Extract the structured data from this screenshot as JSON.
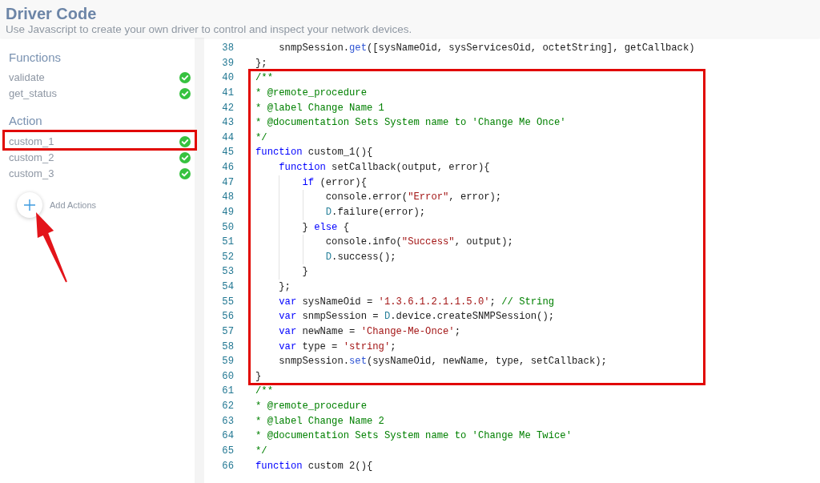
{
  "header": {
    "title": "Driver Code",
    "subtitle": "Use Javascript to create your own driver to control and inspect your network devices."
  },
  "sidebar": {
    "sections": [
      {
        "heading": "Functions",
        "items": [
          {
            "name": "validate",
            "valid": true,
            "highlighted": false
          },
          {
            "name": "get_status",
            "valid": true,
            "highlighted": false
          }
        ]
      },
      {
        "heading": "Action",
        "items": [
          {
            "name": "custom_1",
            "valid": true,
            "highlighted": true
          },
          {
            "name": "custom_2",
            "valid": true,
            "highlighted": false
          },
          {
            "name": "custom_3",
            "valid": true,
            "highlighted": false
          }
        ]
      }
    ],
    "add_button": {
      "label": "Add Actions",
      "pointer_arrow": true
    }
  },
  "editor": {
    "blocks": [
      {
        "highlighted": false,
        "lines": [
          {
            "number": "38",
            "tokens": [
              {
                "kind": "plain",
                "text": "    snmpSession."
              },
              {
                "kind": "method",
                "text": "get"
              },
              {
                "kind": "plain",
                "text": "([sysNameOid, sysServicesOid, octetString], getCallback)"
              }
            ]
          },
          {
            "number": "39",
            "tokens": [
              {
                "kind": "plain",
                "text": "};"
              }
            ]
          }
        ]
      },
      {
        "highlighted": true,
        "lines": [
          {
            "number": "40",
            "tokens": [
              {
                "kind": "comment",
                "text": "/**"
              }
            ]
          },
          {
            "number": "41",
            "tokens": [
              {
                "kind": "comment",
                "text": "* @remote_procedure"
              }
            ]
          },
          {
            "number": "42",
            "tokens": [
              {
                "kind": "comment",
                "text": "* @label Change Name 1"
              }
            ]
          },
          {
            "number": "43",
            "tokens": [
              {
                "kind": "comment",
                "text": "* @documentation Sets System name to 'Change Me Once'"
              }
            ]
          },
          {
            "number": "44",
            "tokens": [
              {
                "kind": "comment",
                "text": "*/"
              }
            ]
          },
          {
            "number": "45",
            "tokens": [
              {
                "kind": "keyword",
                "text": "function"
              },
              {
                "kind": "plain",
                "text": " custom_1(){"
              }
            ]
          },
          {
            "number": "46",
            "tokens": [
              {
                "kind": "keyword",
                "text": "    function"
              },
              {
                "kind": "plain",
                "text": " setCallback(output, error){"
              }
            ]
          },
          {
            "number": "47",
            "tokens": [
              {
                "kind": "keyword",
                "text": "        if"
              },
              {
                "kind": "plain",
                "text": " (error){"
              }
            ]
          },
          {
            "number": "48",
            "tokens": [
              {
                "kind": "plain",
                "text": "            console.error("
              },
              {
                "kind": "string",
                "text": "\"Error\""
              },
              {
                "kind": "plain",
                "text": ", error);"
              }
            ]
          },
          {
            "number": "49",
            "tokens": [
              {
                "kind": "type",
                "text": "            D"
              },
              {
                "kind": "plain",
                "text": ".failure(error);"
              }
            ]
          },
          {
            "number": "50",
            "tokens": [
              {
                "kind": "plain",
                "text": "        } "
              },
              {
                "kind": "keyword",
                "text": "else"
              },
              {
                "kind": "plain",
                "text": " {"
              }
            ]
          },
          {
            "number": "51",
            "tokens": [
              {
                "kind": "plain",
                "text": "            console.info("
              },
              {
                "kind": "string",
                "text": "\"Success\""
              },
              {
                "kind": "plain",
                "text": ", output);"
              }
            ]
          },
          {
            "number": "52",
            "tokens": [
              {
                "kind": "type",
                "text": "            D"
              },
              {
                "kind": "plain",
                "text": ".success();"
              }
            ]
          },
          {
            "number": "53",
            "tokens": [
              {
                "kind": "plain",
                "text": "        }"
              }
            ]
          },
          {
            "number": "54",
            "tokens": [
              {
                "kind": "plain",
                "text": "    };"
              }
            ]
          },
          {
            "number": "55",
            "tokens": [
              {
                "kind": "keyword",
                "text": "    var"
              },
              {
                "kind": "plain",
                "text": " sysNameOid = "
              },
              {
                "kind": "string",
                "text": "'1.3.6.1.2.1.1.5.0'"
              },
              {
                "kind": "plain",
                "text": "; "
              },
              {
                "kind": "comment",
                "text": "// String"
              }
            ]
          },
          {
            "number": "56",
            "tokens": [
              {
                "kind": "keyword",
                "text": "    var"
              },
              {
                "kind": "plain",
                "text": " snmpSession = "
              },
              {
                "kind": "type",
                "text": "D"
              },
              {
                "kind": "plain",
                "text": ".device.createSNMPSession();"
              }
            ]
          },
          {
            "number": "57",
            "tokens": [
              {
                "kind": "keyword",
                "text": "    var"
              },
              {
                "kind": "plain",
                "text": " newName = "
              },
              {
                "kind": "string",
                "text": "'Change-Me-Once'"
              },
              {
                "kind": "plain",
                "text": ";"
              }
            ]
          },
          {
            "number": "58",
            "tokens": [
              {
                "kind": "keyword",
                "text": "    var"
              },
              {
                "kind": "plain",
                "text": " type = "
              },
              {
                "kind": "string",
                "text": "'string'"
              },
              {
                "kind": "plain",
                "text": ";"
              }
            ]
          },
          {
            "number": "59",
            "tokens": [
              {
                "kind": "plain",
                "text": "    snmpSession."
              },
              {
                "kind": "method",
                "text": "set"
              },
              {
                "kind": "plain",
                "text": "(sysNameOid, newName, type, setCallback);"
              }
            ]
          },
          {
            "number": "60",
            "tokens": [
              {
                "kind": "plain",
                "text": "}"
              }
            ]
          }
        ]
      },
      {
        "highlighted": false,
        "lines": [
          {
            "number": "61",
            "tokens": [
              {
                "kind": "comment",
                "text": "/**"
              }
            ]
          },
          {
            "number": "62",
            "tokens": [
              {
                "kind": "comment",
                "text": "* @remote_procedure"
              }
            ]
          },
          {
            "number": "63",
            "tokens": [
              {
                "kind": "comment",
                "text": "* @label Change Name 2"
              }
            ]
          },
          {
            "number": "64",
            "tokens": [
              {
                "kind": "comment",
                "text": "* @documentation Sets System name to 'Change Me Twice'"
              }
            ]
          },
          {
            "number": "65",
            "tokens": [
              {
                "kind": "comment",
                "text": "*/"
              }
            ]
          },
          {
            "number": "66",
            "tokens": [
              {
                "kind": "keyword",
                "text": "function"
              },
              {
                "kind": "plain",
                "text": " custom 2(){"
              }
            ]
          }
        ]
      }
    ]
  }
}
